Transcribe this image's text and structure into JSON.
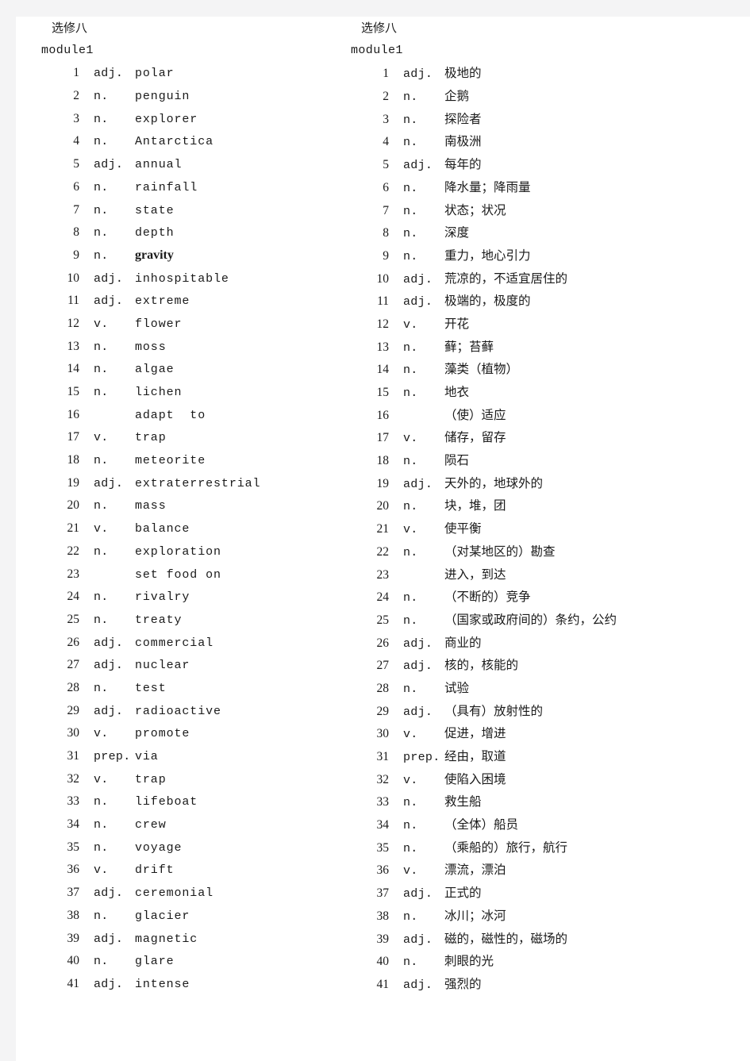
{
  "page": {
    "background_color": "#ffffff",
    "gutter_color": "#f4f4f5",
    "text_color": "#1a1a1a"
  },
  "columns": {
    "english": {
      "title": "选修八",
      "module": "module1"
    },
    "chinese": {
      "title": "选修八",
      "module": "module1"
    }
  },
  "entries": [
    {
      "num": "1",
      "pos": "adj.",
      "word": "polar",
      "def": "极地的"
    },
    {
      "num": "2",
      "pos": "n.",
      "word": "penguin",
      "def": "企鹅"
    },
    {
      "num": "3",
      "pos": "n.",
      "word": "explorer",
      "def": "探险者"
    },
    {
      "num": "4",
      "pos": "n.",
      "word": "Antarctica",
      "def": "南极洲"
    },
    {
      "num": "5",
      "pos": "adj.",
      "word": "annual",
      "def": "每年的"
    },
    {
      "num": "6",
      "pos": "n.",
      "word": "rainfall",
      "def": "降水量；降雨量"
    },
    {
      "num": "7",
      "pos": "n.",
      "word": "state",
      "def": "状态；状况"
    },
    {
      "num": "8",
      "pos": "n.",
      "word": "depth",
      "def": "深度"
    },
    {
      "num": "9",
      "pos": "n.",
      "word": "gravity",
      "def": "重力，地心引力",
      "word_style": "alt-face"
    },
    {
      "num": "10",
      "pos": "adj.",
      "word": "inhospitable",
      "def": "荒凉的，不适宜居住的"
    },
    {
      "num": "11",
      "pos": "adj.",
      "word": "extreme",
      "def": "极端的，极度的"
    },
    {
      "num": "12",
      "pos": "v.",
      "word": "flower",
      "def": "开花"
    },
    {
      "num": "13",
      "pos": "n.",
      "word": "moss",
      "def": "藓；苔藓"
    },
    {
      "num": "14",
      "pos": "n.",
      "word": "algae",
      "def": "藻类（植物）"
    },
    {
      "num": "15",
      "pos": "n.",
      "word": "lichen",
      "def": "地衣"
    },
    {
      "num": "16",
      "pos": "",
      "word": "adapt  to",
      "def": "（使）适应"
    },
    {
      "num": "17",
      "pos": "v.",
      "word": "trap",
      "def": "储存，留存"
    },
    {
      "num": "18",
      "pos": "n.",
      "word": "meteorite",
      "def": "陨石"
    },
    {
      "num": "19",
      "pos": "adj.",
      "word": "extraterrestrial",
      "def": "天外的，地球外的"
    },
    {
      "num": "20",
      "pos": "n.",
      "word": "mass",
      "def": "块，堆，团"
    },
    {
      "num": "21",
      "pos": "v.",
      "word": "balance",
      "def": "使平衡"
    },
    {
      "num": "22",
      "pos": "n.",
      "word": "exploration",
      "def": "（对某地区的）勘查"
    },
    {
      "num": "23",
      "pos": "",
      "word": "set food on",
      "def": "进入，到达"
    },
    {
      "num": "24",
      "pos": "n.",
      "word": "rivalry",
      "def": "（不断的）竞争"
    },
    {
      "num": "25",
      "pos": "n.",
      "word": "treaty",
      "def": "（国家或政府间的）条约，公约"
    },
    {
      "num": "26",
      "pos": "adj.",
      "word": "commercial",
      "def": "商业的"
    },
    {
      "num": "27",
      "pos": "adj.",
      "word": "nuclear",
      "def": "核的，核能的"
    },
    {
      "num": "28",
      "pos": "n.",
      "word": "test",
      "def": "试验"
    },
    {
      "num": "29",
      "pos": "adj.",
      "word": "radioactive",
      "def": "（具有）放射性的"
    },
    {
      "num": "30",
      "pos": "v.",
      "word": "promote",
      "def": "促进，增进"
    },
    {
      "num": "31",
      "pos": "prep.",
      "word": "via",
      "def": "经由，取道"
    },
    {
      "num": "32",
      "pos": "v.",
      "word": "trap",
      "def": "使陷入困境"
    },
    {
      "num": "33",
      "pos": "n.",
      "word": "lifeboat",
      "def": "救生船"
    },
    {
      "num": "34",
      "pos": "n.",
      "word": "crew",
      "def": "（全体）船员"
    },
    {
      "num": "35",
      "pos": "n.",
      "word": "voyage",
      "def": "（乘船的）旅行，航行"
    },
    {
      "num": "36",
      "pos": "v.",
      "word": "drift",
      "def": "漂流，漂泊"
    },
    {
      "num": "37",
      "pos": "adj.",
      "word": "ceremonial",
      "def": "正式的"
    },
    {
      "num": "38",
      "pos": "n.",
      "word": "glacier",
      "def": "冰川；冰河"
    },
    {
      "num": "39",
      "pos": "adj.",
      "word": "magnetic",
      "def": "磁的，磁性的，磁场的"
    },
    {
      "num": "40",
      "pos": "n.",
      "word": "glare",
      "def": "刺眼的光"
    },
    {
      "num": "41",
      "pos": "adj.",
      "word": "intense",
      "def": "强烈的"
    }
  ]
}
